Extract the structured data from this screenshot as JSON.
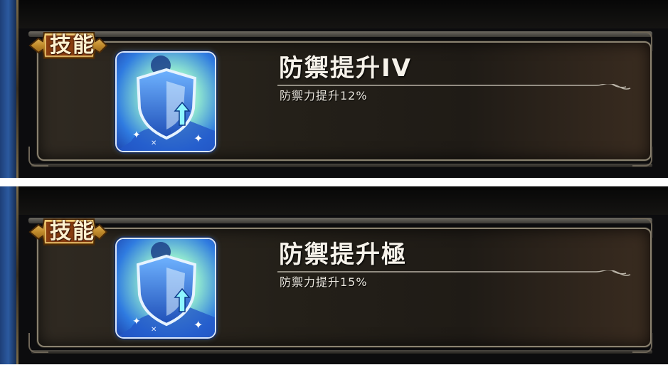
{
  "panels": [
    {
      "badge": "技能",
      "skill_name": "防禦提升IV",
      "skill_desc": "防禦力提升12%",
      "icon": "shield-up-icon"
    },
    {
      "badge": "技能",
      "skill_name": "防禦提升極",
      "skill_desc": "防禦力提升15%",
      "icon": "shield-up-icon"
    }
  ],
  "colors": {
    "frame_border": "#8a8270",
    "badge_gold": "#c08a2a",
    "text": "#f6f2ea",
    "shield_blue": "#2f6fd6"
  }
}
